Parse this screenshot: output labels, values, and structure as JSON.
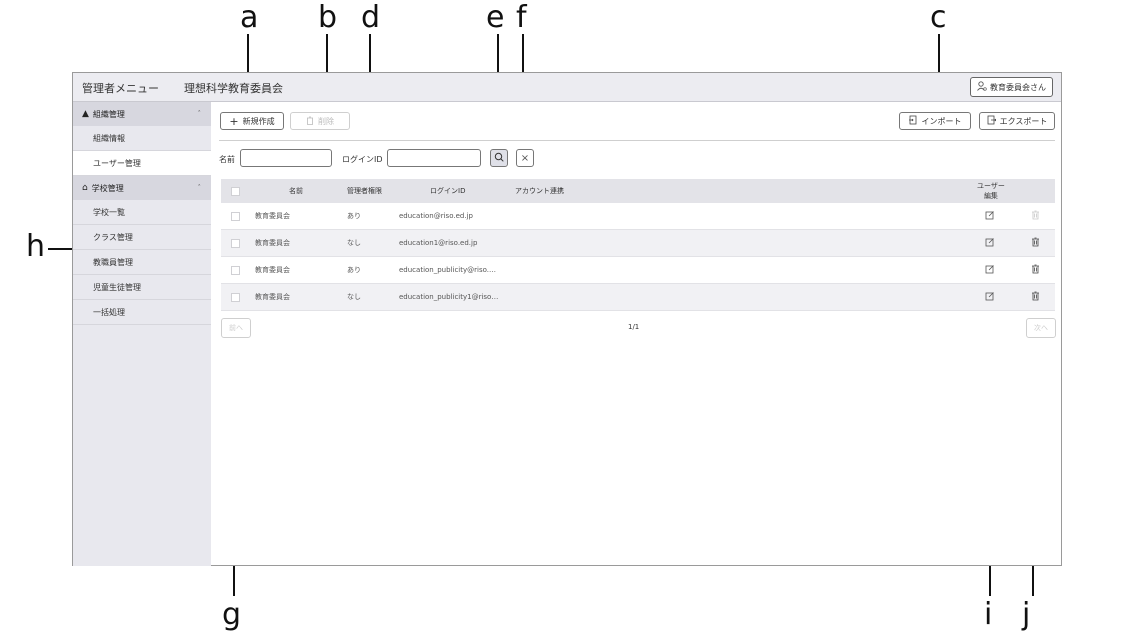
{
  "callouts": {
    "a": "a",
    "b": "b",
    "c": "c",
    "d": "d",
    "e": "e",
    "f": "f",
    "g": "g",
    "h": "h",
    "i": "i",
    "j": "j"
  },
  "topbar": {
    "menu_title": "管理者メニュー",
    "org_name": "理想科学教育委員会",
    "user_label": "教育委員会さん",
    "user_icon": "user-icon"
  },
  "sidebar": {
    "sections": [
      {
        "label": "組織管理",
        "icon": "warning-icon",
        "items": [
          "組織情報",
          "ユーザー管理"
        ]
      },
      {
        "label": "学校管理",
        "icon": "home-icon",
        "items": [
          "学校一覧",
          "クラス管理",
          "教職員管理",
          "児童生徒管理",
          "一括処理"
        ]
      }
    ],
    "active": "ユーザー管理"
  },
  "toolbar": {
    "new_label": "新規作成",
    "delete_label": "削除",
    "import_label": "インポート",
    "export_label": "エクスポート"
  },
  "search": {
    "name_label": "名前",
    "login_label": "ログインID",
    "search_icon": "search-icon",
    "clear_icon": "close-icon"
  },
  "table": {
    "headers": {
      "name": "名前",
      "admin": "管理者権限",
      "login": "ログインID",
      "account": "アカウント連携",
      "user_edit_1": "ユーザー",
      "user_edit_2": "編集"
    },
    "rows": [
      {
        "name": "教育委員会",
        "admin": "あり",
        "login": "education@riso.ed.jp",
        "delete_enabled": false
      },
      {
        "name": "教育委員会",
        "admin": "なし",
        "login": "education1@riso.ed.jp",
        "delete_enabled": true
      },
      {
        "name": "教育委員会",
        "admin": "あり",
        "login": "education_publicity@riso.…",
        "delete_enabled": true
      },
      {
        "name": "教育委員会",
        "admin": "なし",
        "login": "education_publicity1@riso…",
        "delete_enabled": true
      }
    ]
  },
  "pagination": {
    "prev_label": "前へ",
    "next_label": "次へ",
    "page": "1/1"
  }
}
